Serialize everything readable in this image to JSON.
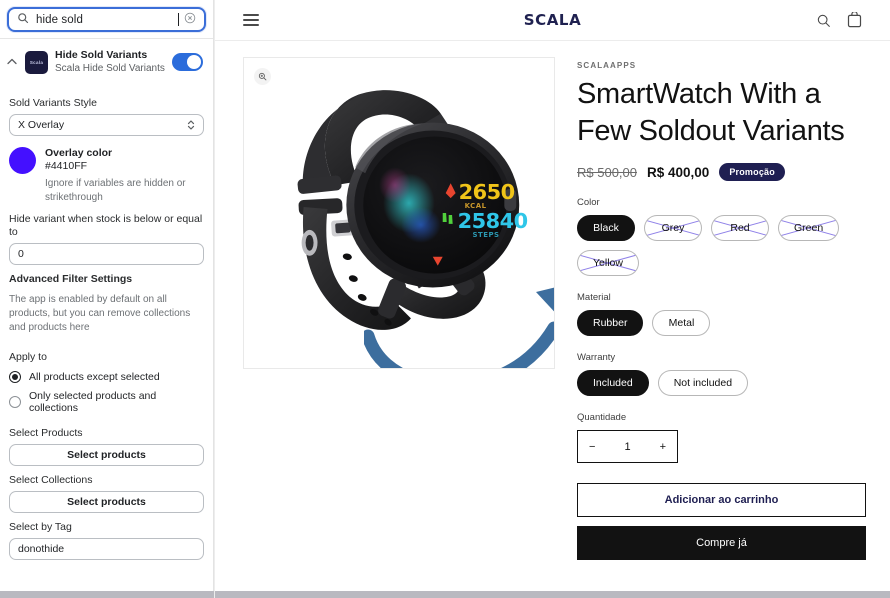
{
  "sidebar": {
    "search": {
      "value": "hide sold",
      "placeholder": "Search",
      "icon": "search-icon",
      "clear_icon": "clear-circle-icon"
    },
    "app_row": {
      "collapse_icon": "chevron-up-icon",
      "icon_text": "Scala",
      "title": "Hide Sold Variants",
      "subtitle": "Scala Hide Sold Variants",
      "toggle_on": true
    },
    "style_field": {
      "label": "Sold Variants Style",
      "value": "X Overlay"
    },
    "overlay_color": {
      "name": "Overlay color",
      "hex": "#4410FF",
      "note": "Ignore if variables are hidden or strikethrough"
    },
    "stock_field": {
      "label": "Hide variant when stock is below or equal to",
      "value": "0"
    },
    "advanced": {
      "heading": "Advanced Filter Settings",
      "paragraph": "The app is enabled by default on all products, but you can remove collections and products here"
    },
    "apply_to": {
      "label": "Apply to",
      "options": [
        {
          "label": "All products except selected",
          "selected": true
        },
        {
          "label": "Only selected products and collections",
          "selected": false
        }
      ]
    },
    "select_products": {
      "label": "Select Products",
      "button": "Select products"
    },
    "select_collections": {
      "label": "Select Collections",
      "button": "Select products"
    },
    "select_tag": {
      "label": "Select by Tag",
      "value": "donothide"
    }
  },
  "store": {
    "header": {
      "menu_icon": "hamburger-menu-icon",
      "brand": "SCALA",
      "search_icon": "search-icon",
      "cart_icon": "shopping-bag-icon"
    },
    "gallery": {
      "zoom_icon": "zoom-in-icon",
      "watch_display": {
        "calories_value": "2650",
        "calories_unit": "KCAL",
        "steps_value": "25840",
        "steps_unit": "STEPS"
      }
    },
    "product": {
      "vendor": "SCALAAPPS",
      "title": "SmartWatch With a Few Soldout Variants",
      "price_old": "R$ 500,00",
      "price_new": "R$ 400,00",
      "badge": "Promoção",
      "options": [
        {
          "label": "Color",
          "values": [
            {
              "label": "Black",
              "state": "selected"
            },
            {
              "label": "Grey",
              "state": "soldout"
            },
            {
              "label": "Red",
              "state": "soldout"
            },
            {
              "label": "Green",
              "state": "soldout"
            },
            {
              "label": "Yellow",
              "state": "soldout"
            }
          ]
        },
        {
          "label": "Material",
          "values": [
            {
              "label": "Rubber",
              "state": "selected"
            },
            {
              "label": "Metal",
              "state": "available"
            }
          ]
        },
        {
          "label": "Warranty",
          "values": [
            {
              "label": "Included",
              "state": "selected"
            },
            {
              "label": "Not included",
              "state": "available"
            }
          ]
        }
      ],
      "quantity": {
        "label": "Quantidade",
        "minus": "−",
        "value": "1",
        "plus": "+"
      },
      "add_to_cart": "Adicionar ao carrinho",
      "buy_now": "Compre já"
    }
  },
  "colors": {
    "overlay": "#4410FF",
    "overlay_x_line": "#6a57e0",
    "toggle_on": "#2b6cdb",
    "brand_navy": "#1f2150",
    "badge_navy": "#1f1f52",
    "arrow_blue": "#3d6e9e",
    "black": "#121212"
  }
}
